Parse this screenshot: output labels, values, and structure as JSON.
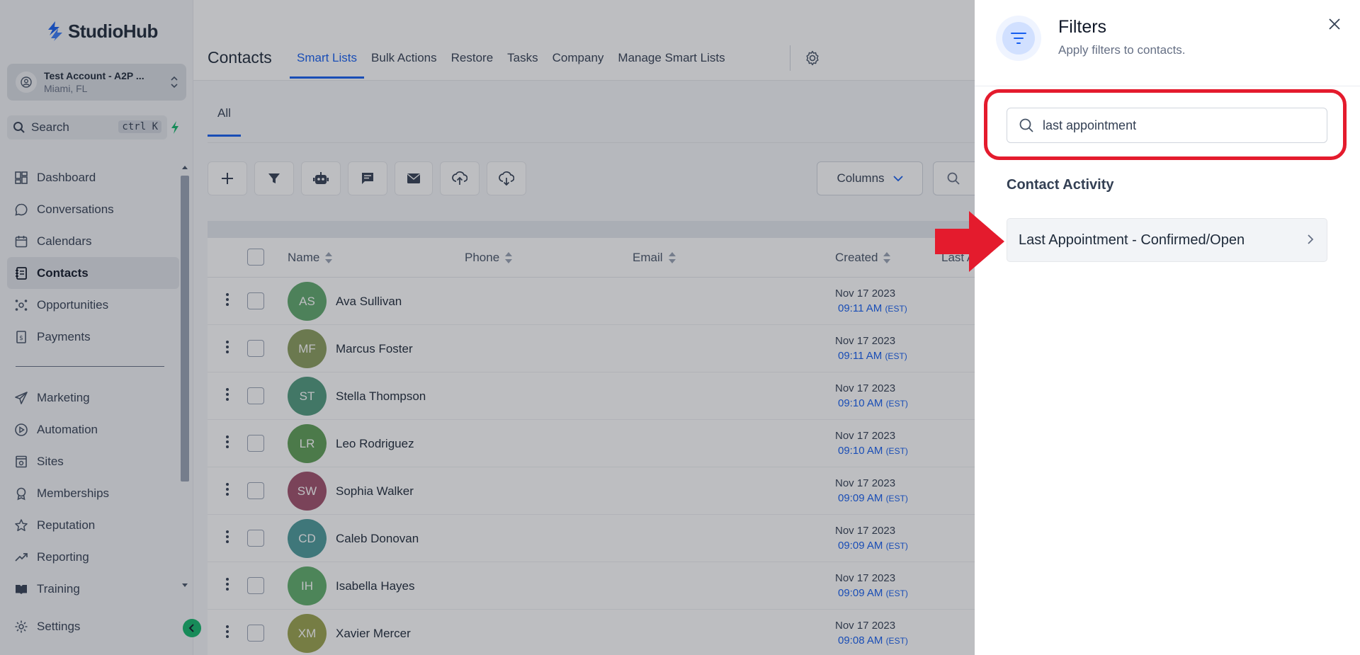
{
  "brand": {
    "name": "StudioHub",
    "accent": "#155eef"
  },
  "account": {
    "name": "Test Account - A2P ...",
    "location": "Miami, FL"
  },
  "search": {
    "label": "Search",
    "shortcut": "ctrl K"
  },
  "sidebar": {
    "items": [
      {
        "label": "Dashboard",
        "icon": "dashboard-icon"
      },
      {
        "label": "Conversations",
        "icon": "chat-icon"
      },
      {
        "label": "Calendars",
        "icon": "calendar-icon"
      },
      {
        "label": "Contacts",
        "icon": "contacts-icon",
        "active": true
      },
      {
        "label": "Opportunities",
        "icon": "opportunities-icon"
      },
      {
        "label": "Payments",
        "icon": "payments-icon"
      }
    ],
    "items2": [
      {
        "label": "Marketing",
        "icon": "send-icon"
      },
      {
        "label": "Automation",
        "icon": "automation-icon"
      },
      {
        "label": "Sites",
        "icon": "sites-icon"
      },
      {
        "label": "Memberships",
        "icon": "memberships-icon"
      },
      {
        "label": "Reputation",
        "icon": "star-icon"
      },
      {
        "label": "Reporting",
        "icon": "trend-icon"
      },
      {
        "label": "Training",
        "icon": "book-icon"
      }
    ],
    "settings": "Settings"
  },
  "header": {
    "title": "Contacts",
    "tabs": [
      "Smart Lists",
      "Bulk Actions",
      "Restore",
      "Tasks",
      "Company",
      "Manage Smart Lists"
    ]
  },
  "subtabs": {
    "all": "All"
  },
  "toolbar": {
    "columns": "Columns"
  },
  "table": {
    "headers": {
      "name": "Name",
      "phone": "Phone",
      "email": "Email",
      "created": "Created",
      "last": "Last Ac"
    },
    "rows": [
      {
        "initials": "AS",
        "name": "Ava Sullivan",
        "date": "Nov 17 2023",
        "time": "09:11 AM",
        "tz": "(EST)",
        "color": "#5fa86c"
      },
      {
        "initials": "MF",
        "name": "Marcus Foster",
        "date": "Nov 17 2023",
        "time": "09:11 AM",
        "tz": "(EST)",
        "color": "#8a9c5c"
      },
      {
        "initials": "ST",
        "name": "Stella Thompson",
        "date": "Nov 17 2023",
        "time": "09:10 AM",
        "tz": "(EST)",
        "color": "#4f9a7d"
      },
      {
        "initials": "LR",
        "name": "Leo Rodriguez",
        "date": "Nov 17 2023",
        "time": "09:10 AM",
        "tz": "(EST)",
        "color": "#5e9e55"
      },
      {
        "initials": "SW",
        "name": "Sophia Walker",
        "date": "Nov 17 2023",
        "time": "09:09 AM",
        "tz": "(EST)",
        "color": "#a04f6a"
      },
      {
        "initials": "CD",
        "name": "Caleb Donovan",
        "date": "Nov 17 2023",
        "time": "09:09 AM",
        "tz": "(EST)",
        "color": "#4b9a9a"
      },
      {
        "initials": "IH",
        "name": "Isabella Hayes",
        "date": "Nov 17 2023",
        "time": "09:09 AM",
        "tz": "(EST)",
        "color": "#5fae6a"
      },
      {
        "initials": "XM",
        "name": "Xavier Mercer",
        "date": "Nov 17 2023",
        "time": "09:08 AM",
        "tz": "(EST)",
        "color": "#9aa34c"
      }
    ]
  },
  "drawer": {
    "title": "Filters",
    "subtitle": "Apply filters to contacts.",
    "search_value": "last appointment",
    "section": "Contact Activity",
    "option": "Last Appointment - Confirmed/Open"
  }
}
